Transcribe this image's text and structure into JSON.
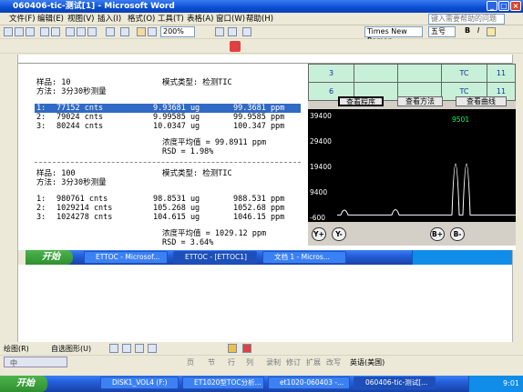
{
  "window": {
    "title": "060406-tic-测试[1] - Microsoft Word",
    "min": "_",
    "max": "□",
    "close": "×"
  },
  "menu": [
    "文件(F)",
    "编辑(E)",
    "视图(V)",
    "插入(I)",
    "格式(O)",
    "工具(T)",
    "表格(A)",
    "窗口(W)",
    "帮助(H)"
  ],
  "help_box": {
    "placeholder": "键入需要帮助的问题"
  },
  "toolbar": {
    "zoom": "200%",
    "font": "Times New Roman",
    "size": "五号",
    "bold": "B",
    "italic": "I"
  },
  "doc": {
    "s1": {
      "sample": "样品: 10",
      "mode": "模式类型: 检测TIC",
      "method": "方法: 3分30秒测量",
      "rows": [
        {
          "n": "1:",
          "cnts": "77152 cnts",
          "ug": "9.93681 ug",
          "ppm": "99.3681 ppm"
        },
        {
          "n": "2:",
          "cnts": "79024 cnts",
          "ug": "9.99585 ug",
          "ppm": "99.9585 ppm"
        },
        {
          "n": "3:",
          "cnts": "80244 cnts",
          "ug": "10.0347 ug",
          "ppm": "100.347 ppm"
        }
      ],
      "avg": "浓度平均值 = 99.8911 ppm",
      "rsd": "RSD = 1.98%"
    },
    "s2": {
      "sample": "样品: 100",
      "mode": "模式类型: 检测TIC",
      "method": "方法: 3分30秒测量",
      "rows": [
        {
          "n": "1:",
          "cnts": "980761 cnts",
          "ug": "98.8531 ug",
          "ppm": "988.531 ppm"
        },
        {
          "n": "2:",
          "cnts": "1029214 cnts",
          "ug": "105.268 ug",
          "ppm": "1052.68 ppm"
        },
        {
          "n": "3:",
          "cnts": "1024278 cnts",
          "ug": "104.615 ug",
          "ppm": "1046.15 ppm"
        }
      ],
      "avg": "浓度平均值 = 1029.12 ppm",
      "rsd": "RSD = 3.64%"
    }
  },
  "app": {
    "grid": [
      [
        "3",
        "",
        "",
        "TC",
        "11"
      ],
      [
        "6",
        "",
        "",
        "TC",
        "11"
      ]
    ],
    "btn_program": "查看程序",
    "btn_method": "查看方法",
    "btn_curve": "查看曲线",
    "y_labels": [
      "39400",
      "29400",
      "19400",
      "9400",
      "-600"
    ],
    "peak_label": "9501",
    "btns": [
      "Y+",
      "Y-",
      "B+",
      "B-"
    ],
    "chart_data": {
      "type": "line",
      "title": "",
      "ylim": [
        -600,
        39400
      ],
      "peaks": [
        {
          "x": 1,
          "y": 3100
        },
        {
          "x": 2,
          "y": 3400
        },
        {
          "x": 3,
          "y": 39400
        },
        {
          "x": 4,
          "y": 39400
        }
      ]
    }
  },
  "taskbar_inner": {
    "start": "开始",
    "items": [
      "ETTOC - Microsof...",
      "ETTOC - [ETTOC1]",
      "文档 1 - Micros..."
    ]
  },
  "draw_toolbar": {
    "draw": "绘图(R)",
    "autoshape": "自选图形(U)"
  },
  "ime": {
    "text": "中"
  },
  "status": {
    "page": "页",
    "section": "节",
    "pos": "行",
    "col": "列",
    "rec": "录制",
    "rev": "修订",
    "ext": "扩展",
    "ovr": "改写",
    "lang": "英语(美国)"
  },
  "taskbar": {
    "start": "开始",
    "items": [
      "DISK1_VOL4 (F:)",
      "ET1020型TOC分析...",
      "et1020-060403 -...",
      "060406-tic-测试[..."
    ],
    "clock": "9:01"
  }
}
